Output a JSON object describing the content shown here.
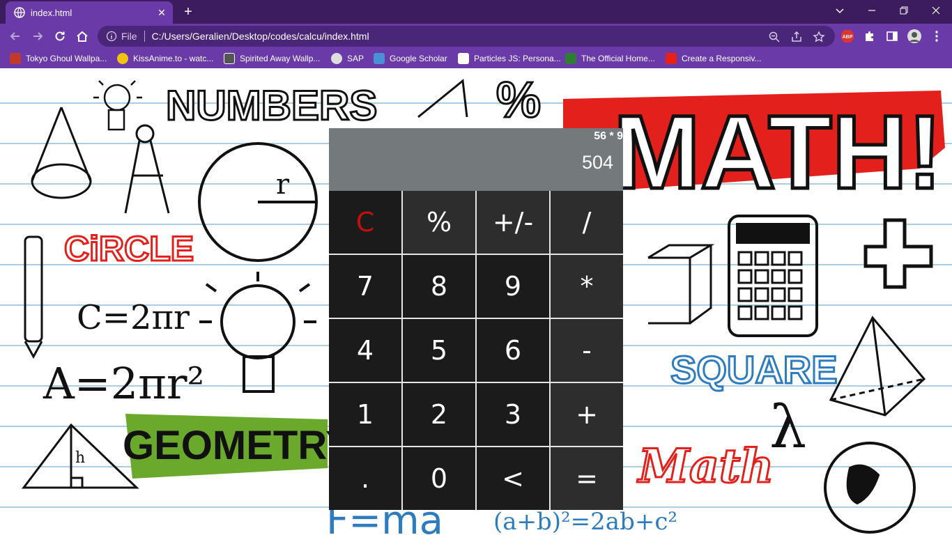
{
  "browser": {
    "tab_title": "index.html",
    "new_tab": "+",
    "url_scheme": "File",
    "url": "C:/Users/Geralien/Desktop/codes/calcu/index.html",
    "extension_badge": "ABP",
    "bookmarks": [
      {
        "label": "Tokyo Ghoul Wallpa...",
        "icon": "anime-icon",
        "color": "#c0392b"
      },
      {
        "label": "KissAnime.to - watc...",
        "icon": "kissanime-icon",
        "color": "#f1c40f"
      },
      {
        "label": "Spirited Away Wallp...",
        "icon": "hd-icon",
        "color": "#555555"
      },
      {
        "label": "SAP",
        "icon": "globe-icon",
        "color": "#dddddd"
      },
      {
        "label": "Google Scholar",
        "icon": "scholar-icon",
        "color": "#4a90d9"
      },
      {
        "label": "Particles JS: Persona...",
        "icon": "codepen-icon",
        "color": "#ffffff"
      },
      {
        "label": "The Official Home...",
        "icon": "site-icon",
        "color": "#2e7d32"
      },
      {
        "label": "Create a Responsiv...",
        "icon": "youtube-icon",
        "color": "#e62117"
      }
    ]
  },
  "page": {
    "background_words": {
      "numbers": "NUMBERS",
      "math": "MATH!",
      "circle": "CiRCLE",
      "square": "SQUARE",
      "geometry": "GEOMETRY",
      "math_script": "Math",
      "formula_c": "C=2πr",
      "formula_a": "A=2πr²",
      "formula_f": "F=ma",
      "formula_ab": "(a+b)²=2ab+c²"
    }
  },
  "calculator": {
    "expression": "56 * 9",
    "result": "504",
    "keys": [
      {
        "label": "C",
        "kind": "clear"
      },
      {
        "label": "%",
        "kind": "op"
      },
      {
        "label": "+/-",
        "kind": "op"
      },
      {
        "label": "/",
        "kind": "op"
      },
      {
        "label": "7",
        "kind": "num"
      },
      {
        "label": "8",
        "kind": "num"
      },
      {
        "label": "9",
        "kind": "num"
      },
      {
        "label": "*",
        "kind": "op"
      },
      {
        "label": "4",
        "kind": "num"
      },
      {
        "label": "5",
        "kind": "num"
      },
      {
        "label": "6",
        "kind": "num"
      },
      {
        "label": "-",
        "kind": "op"
      },
      {
        "label": "1",
        "kind": "num"
      },
      {
        "label": "2",
        "kind": "num"
      },
      {
        "label": "3",
        "kind": "num"
      },
      {
        "label": "+",
        "kind": "op"
      },
      {
        "label": ".",
        "kind": "num"
      },
      {
        "label": "0",
        "kind": "num"
      },
      {
        "label": "<",
        "kind": "num"
      },
      {
        "label": "=",
        "kind": "op"
      }
    ]
  },
  "colors": {
    "tabbar": "#3c1b5e",
    "toolbar": "#6a3aa8",
    "display": "#74797c",
    "key": "#1b1b1b",
    "clear": "#c01010"
  }
}
